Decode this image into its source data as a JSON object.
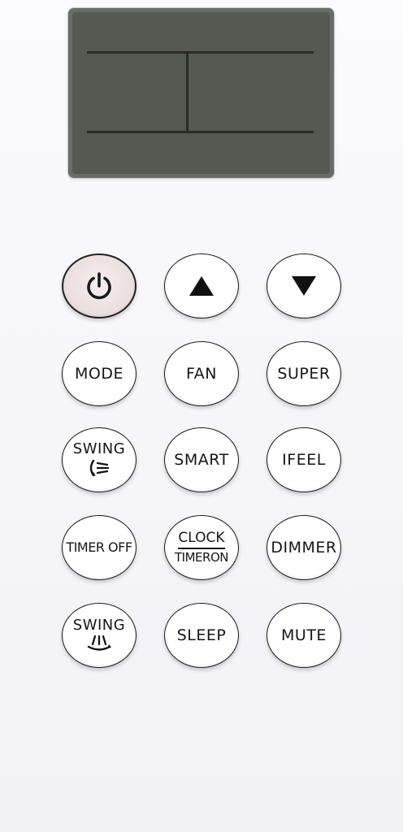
{
  "remote": {
    "buttons": {
      "power": {
        "icon": "power-icon"
      },
      "temp_up": {
        "icon": "triangle-up-icon"
      },
      "temp_down": {
        "icon": "triangle-down-icon"
      },
      "mode": "MODE",
      "fan": "FAN",
      "super": "SUPER",
      "swing_vertical": {
        "label": "SWING",
        "icon": "swing-vertical-icon"
      },
      "smart": "SMART",
      "ifeel": "IFEEL",
      "timer_off": "TIMER OFF",
      "clock_timer_on": {
        "top": "CLOCK",
        "bottom": "TIMERON"
      },
      "dimmer": "DIMMER",
      "swing_horizontal": {
        "label": "SWING",
        "icon": "swing-horizontal-icon"
      },
      "sleep": "SLEEP",
      "mute": "MUTE"
    },
    "colors": {
      "lcd": "#565852",
      "button_face": "#ffffff",
      "power_face": "#eadde0",
      "outline": "#1a1a1a"
    }
  }
}
